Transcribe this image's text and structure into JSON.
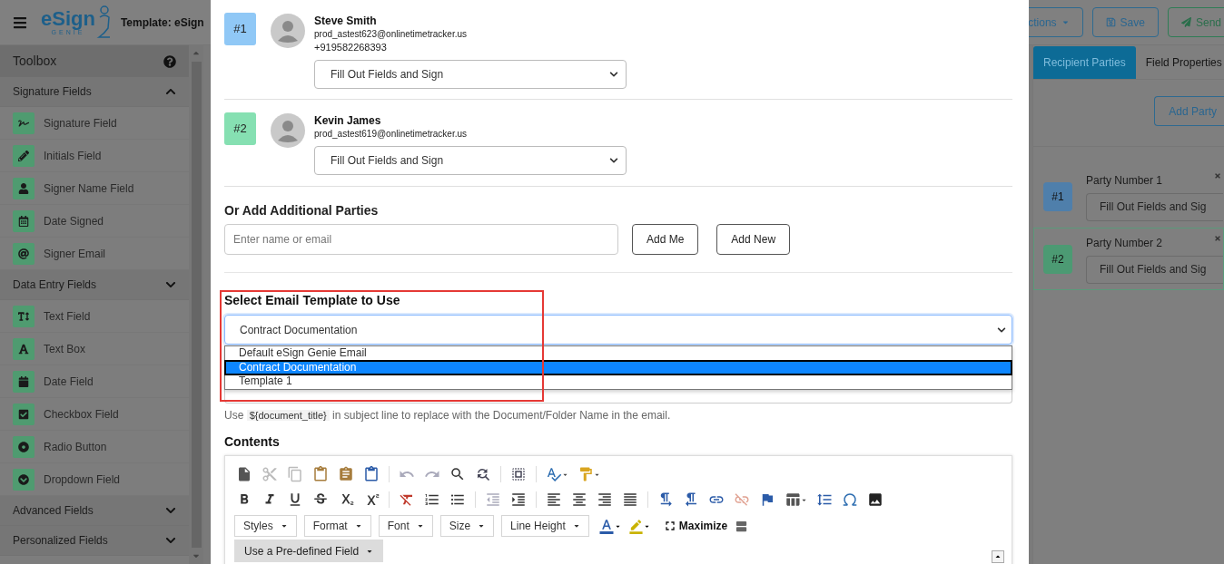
{
  "header": {
    "logo": {
      "word": "eSign",
      "tag": "GENIE"
    },
    "template_title": "Template: eSign",
    "actions": [
      {
        "label": "ctions",
        "kind": "menu"
      },
      {
        "label": "Save",
        "kind": "save"
      },
      {
        "label": "Send",
        "kind": "send"
      }
    ]
  },
  "toolbox": {
    "title": "Toolbox",
    "sections": [
      {
        "title": "Signature Fields",
        "expanded": true,
        "items": [
          {
            "label": "Signature Field"
          },
          {
            "label": "Initials Field"
          },
          {
            "label": "Signer Name Field"
          },
          {
            "label": "Date Signed"
          },
          {
            "label": "Signer Email"
          }
        ]
      },
      {
        "title": "Data Entry Fields",
        "expanded": false,
        "items": [
          {
            "label": "Text Field"
          },
          {
            "label": "Text Box"
          },
          {
            "label": "Date Field"
          },
          {
            "label": "Checkbox Field"
          },
          {
            "label": "Radio Button"
          },
          {
            "label": "Dropdown Field"
          }
        ]
      },
      {
        "title": "Advanced Fields",
        "expanded": false
      },
      {
        "title": "Personalized Fields",
        "expanded": false
      }
    ]
  },
  "right_panel": {
    "tabs": [
      {
        "label": "Recipient Parties",
        "selected": true
      },
      {
        "label": "Field Properties",
        "selected": false
      }
    ],
    "add_party": "Add Party",
    "parties": [
      {
        "number": "#1",
        "label": "Party Number 1",
        "role": "Fill Out Fields and Sig",
        "color": "#4f7fab",
        "selected": false
      },
      {
        "number": "#2",
        "label": "Party Number 2",
        "role": "Fill Out Fields and Sig",
        "color": "#4c9a73",
        "selected": true
      }
    ]
  },
  "dialog": {
    "recipients": [
      {
        "number": "#1",
        "color": "#90c8f6",
        "name": "Steve Smith",
        "email": "prod_astest623@onlinetimetracker.us",
        "phone": "+919582268393",
        "role": "Fill Out Fields and Sign"
      },
      {
        "number": "#2",
        "color": "#86e0b2",
        "name": "Kevin James",
        "email": "prod_astest619@onlinetimetracker.us",
        "role": "Fill Out Fields and Sign"
      }
    ],
    "add_heading": "Or Add Additional Parties",
    "add_placeholder": "Enter name or email",
    "add_buttons": [
      "Add Me",
      "Add New"
    ],
    "template_heading": "Select Email Template to Use",
    "template_value": "Contract Documentation",
    "template_options": [
      {
        "label": "Default eSign Genie Email",
        "selected": false
      },
      {
        "label": "Contract Documentation",
        "selected": true
      },
      {
        "label": "Template 1",
        "selected": false
      }
    ],
    "hint": {
      "before": "Use",
      "code": "${document_title}",
      "after": "in subject line to replace with the Document/Folder Name in the email."
    },
    "contents_heading": "Contents",
    "editor_dropdowns": [
      "Styles",
      "Format",
      "Font",
      "Size",
      "Line Height"
    ],
    "maximize": "Maximize",
    "field_button": "Use a Pre-defined Field"
  }
}
